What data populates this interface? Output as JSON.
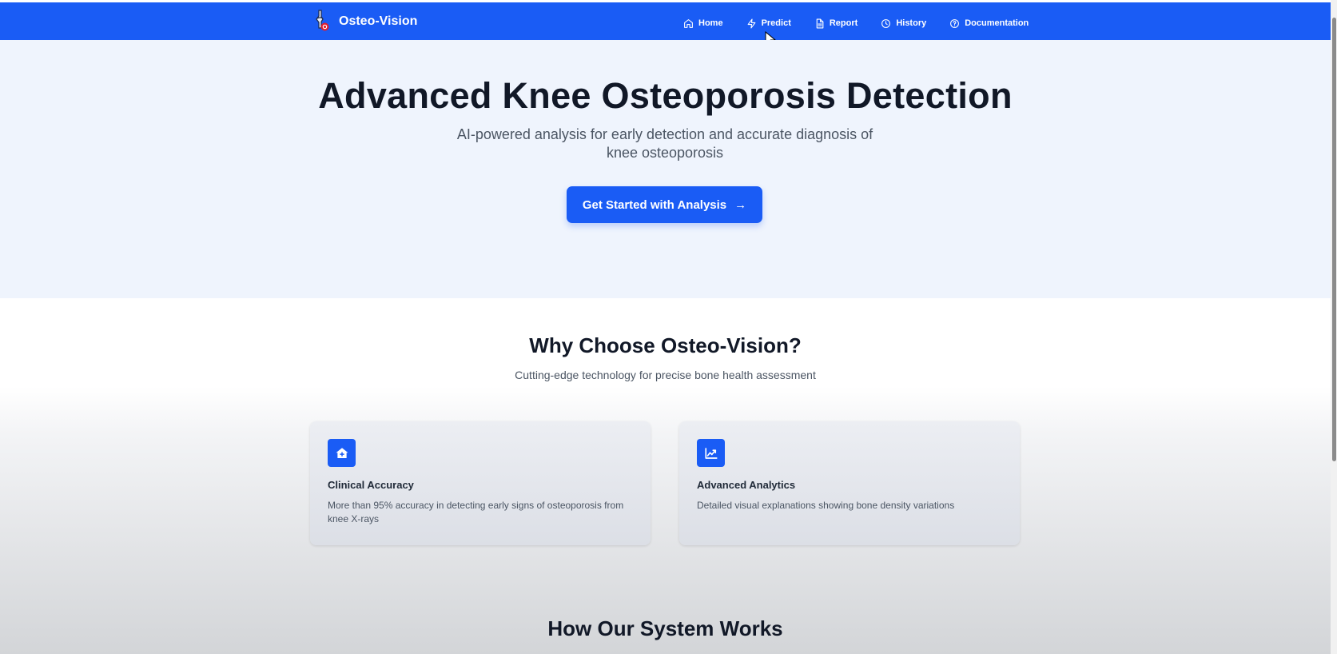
{
  "brand": {
    "name": "Osteo-Vision",
    "logo_icon": "knee-joint-logo"
  },
  "nav": {
    "items": [
      {
        "label": "Home",
        "icon": "home-icon"
      },
      {
        "label": "Predict",
        "icon": "activity-icon"
      },
      {
        "label": "Report",
        "icon": "document-icon"
      },
      {
        "label": "History",
        "icon": "clock-icon"
      },
      {
        "label": "Documentation",
        "icon": "help-circle-icon"
      }
    ]
  },
  "hero": {
    "title": "Advanced Knee Osteoporosis Detection",
    "subtitle": "AI-powered analysis for early detection and accurate diagnosis of knee osteoporosis",
    "cta_label": "Get Started with Analysis",
    "cta_arrow": "→"
  },
  "features": {
    "title": "Why Choose Osteo-Vision?",
    "subtitle": "Cutting-edge technology for precise bone health assessment",
    "cards": [
      {
        "icon": "medical-home-icon",
        "title": "Clinical Accuracy",
        "text": "More than 95% accuracy in detecting early signs of osteoporosis from knee X-rays"
      },
      {
        "icon": "chart-trend-icon",
        "title": "Advanced Analytics",
        "text": "Detailed visual explanations showing bone density variations"
      }
    ]
  },
  "how_it_works": {
    "title": "How Our System Works"
  },
  "colors": {
    "primary": "#1a5cf5",
    "hero_bg": "#eff4fd",
    "heading": "#111827",
    "body_text": "#4b5563"
  }
}
